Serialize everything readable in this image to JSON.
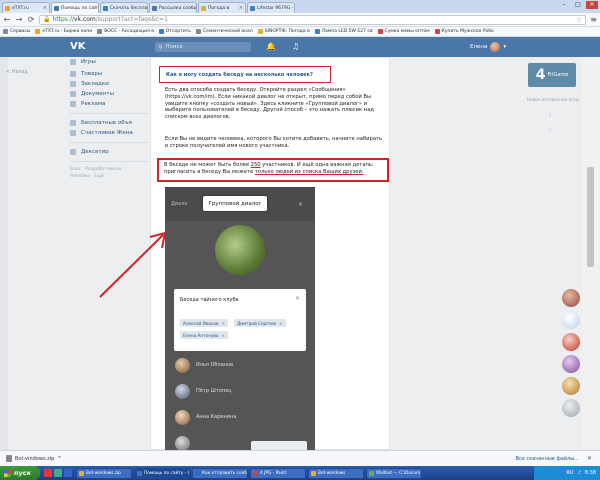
{
  "browser": {
    "tabs": [
      {
        "label": "eTXT.ru",
        "active": false,
        "color": "#f0a030"
      },
      {
        "label": "Помощь по сайту",
        "active": true,
        "color": "#4a76a8"
      },
      {
        "label": "Скачать бесплатно Bot",
        "active": false,
        "color": "#3b82c4"
      },
      {
        "label": "Рассылка сообщений Виспа",
        "active": false,
        "color": "#4a76a8"
      },
      {
        "label": "Погода в",
        "active": false,
        "color": "#e0b030"
      },
      {
        "label": "Lifestar 9679G - прогр",
        "active": false,
        "color": "#3b82c4"
      }
    ],
    "address": {
      "scheme": "https://",
      "host": "vk.com",
      "path": "/support?act=faqs&c=1"
    },
    "bookmarks": [
      {
        "label": "Сервисы",
        "color": "#7c8da3"
      },
      {
        "label": "eTXT.ru - Биржа копи",
        "color": "#f0a030"
      },
      {
        "label": "ВОСС - Ассоциация в",
        "color": "#888"
      },
      {
        "label": "Отсортить",
        "color": "#3b82c4"
      },
      {
        "label": "Семантический анал",
        "color": "#888"
      },
      {
        "label": "SINOPTIK: Погода в",
        "color": "#e0b030"
      },
      {
        "label": "Лампа LED 5W E27 св",
        "color": "#3b82c4"
      },
      {
        "label": "Сумка мамы оптом",
        "color": "#c44"
      },
      {
        "label": "Купить Мужская Робо",
        "color": "#c44"
      }
    ]
  },
  "vk": {
    "search_placeholder": "Поиск",
    "user_name": "Елена",
    "back_label": "< Назад",
    "sidebar": {
      "top": [
        "Игры"
      ],
      "main": [
        "Товары",
        "Закладки",
        "Документы",
        "Реклама"
      ],
      "groups": [
        "Бесплатные объя",
        "Счастливая Жена"
      ],
      "extra": [
        "Дексетир"
      ],
      "footer": [
        "Блог",
        "Разработчикам",
        "Реклама",
        "Ещё"
      ]
    },
    "question": "Как я могу создать беседу на несколько человек?",
    "paragraph_1": "Есть два способа создать беседу. Откройте раздел «Сообщения» (https://vk.com/im). Если никакой диалог не открыт, прямо перед собой Вы увидите кнопку «создать новый». Здесь кликните «Групповой диалог» и выберите пользователей в беседу. Другой способ – это нажать плюсик над списком всех диалогов.",
    "paragraph_2": "Если Вы не видите человека, которого Вы хотите добавить, начните набирать в строке получателей имя нового участника.",
    "paragraph_3_start": "В беседе не может быть более ",
    "paragraph_3_num": "250",
    "paragraph_3_mid": " участников. И ещё одна важная деталь: пригласить в беседу Вы можете ",
    "paragraph_3_end": "только людей из списка Ваших друзей.",
    "phone": {
      "tab_label": "Диало",
      "group_dialog": "Групповой диалог",
      "dialog_title": "Беседа тайного клуба",
      "chips": [
        "Алексей Иванов",
        "Дмитрий Сергеев",
        "Елена Антонова"
      ],
      "contacts": [
        "Илья Обланов",
        "Пётр Штопец",
        "Анна Каренина"
      ]
    },
    "right": {
      "logo_num": "4",
      "logo_text": "FriGame",
      "note": "Новые интересные игры"
    }
  },
  "downloads": {
    "file": "Bot-vindows.zip",
    "show_all": "Все скачанные файлы..."
  },
  "taskbar": {
    "start": "пуск",
    "tasks": [
      {
        "label": "Bot-windows.zip",
        "color": "#e0b030"
      },
      {
        "label": "Помощь по сайту - G",
        "color": "#4a76a8"
      },
      {
        "label": "Как отправить сооб",
        "color": "#2b6cd1"
      },
      {
        "label": "4 JPG - Paint",
        "color": "#c44"
      },
      {
        "label": "Bot-windows",
        "color": "#e0b030"
      },
      {
        "label": "Wallbot — C:\\Docum",
        "color": "#6a6"
      }
    ],
    "lang": "RU",
    "time": "8:38"
  }
}
